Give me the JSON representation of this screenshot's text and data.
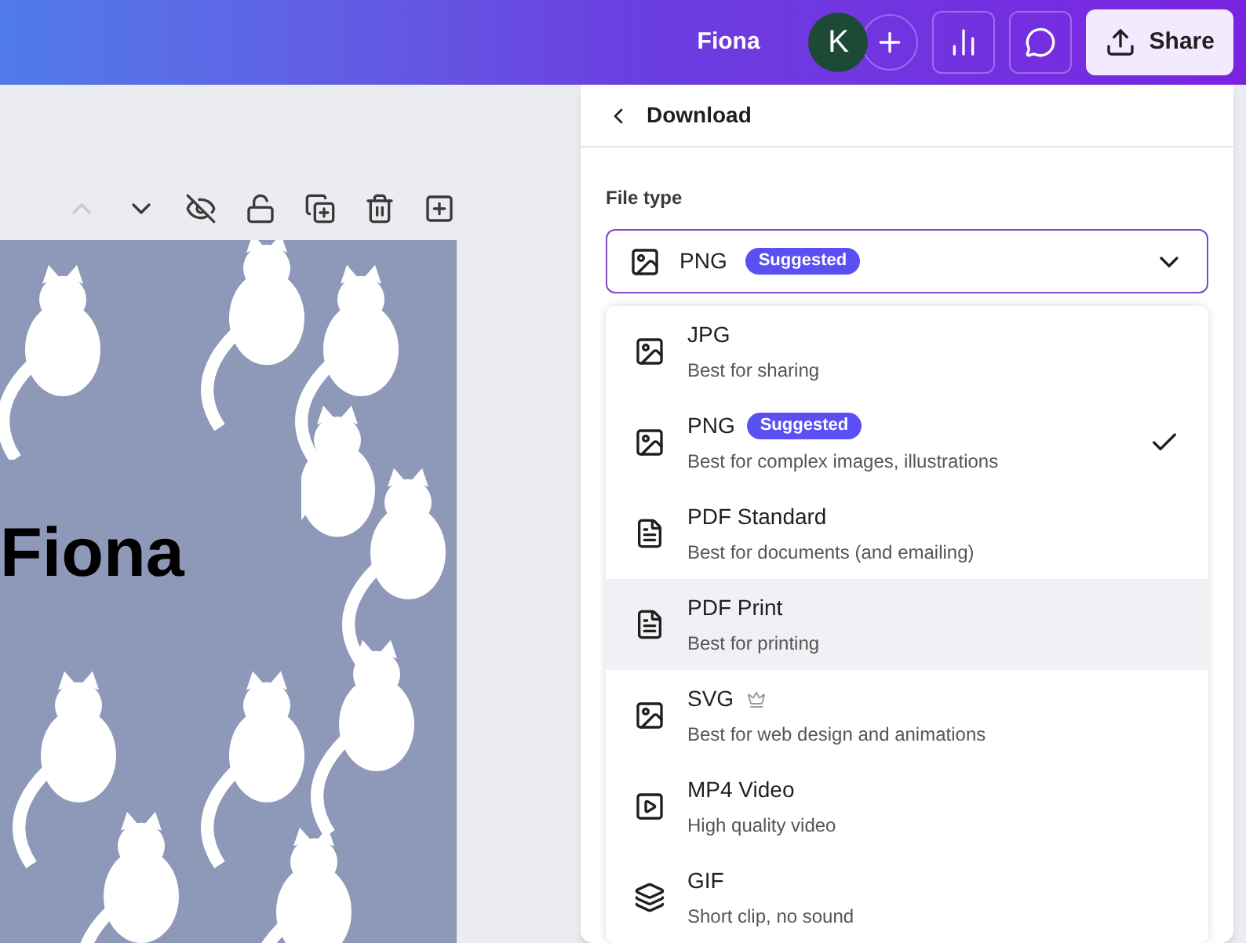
{
  "top_bar": {
    "title": "Fiona",
    "avatar_initial": "K",
    "share_label": "Share"
  },
  "design": {
    "headline": "Fiona"
  },
  "toolbar": {
    "move_up_disabled": true
  },
  "download_panel": {
    "title": "Download",
    "file_type_label": "File type",
    "selected_type": {
      "name": "PNG",
      "badge": "Suggested",
      "kind": "image"
    },
    "options": [
      {
        "kind": "image",
        "name": "JPG",
        "description": "Best for sharing",
        "checked": false,
        "hovered": false,
        "premium": false
      },
      {
        "kind": "image",
        "name": "PNG",
        "badge": "Suggested",
        "description": "Best for complex images, illustrations",
        "checked": true,
        "hovered": false,
        "premium": false
      },
      {
        "kind": "document",
        "name": "PDF Standard",
        "description": "Best for documents (and emailing)",
        "checked": false,
        "hovered": false,
        "premium": false
      },
      {
        "kind": "document",
        "name": "PDF Print",
        "description": "Best for printing",
        "checked": false,
        "hovered": true,
        "premium": false
      },
      {
        "kind": "image",
        "name": "SVG",
        "description": "Best for web design and animations",
        "checked": false,
        "hovered": false,
        "premium": true
      },
      {
        "kind": "video",
        "name": "MP4 Video",
        "description": "High quality video",
        "checked": false,
        "hovered": false,
        "premium": false
      },
      {
        "kind": "gif",
        "name": "GIF",
        "description": "Short clip, no sound",
        "checked": false,
        "hovered": false,
        "premium": false
      }
    ]
  }
}
